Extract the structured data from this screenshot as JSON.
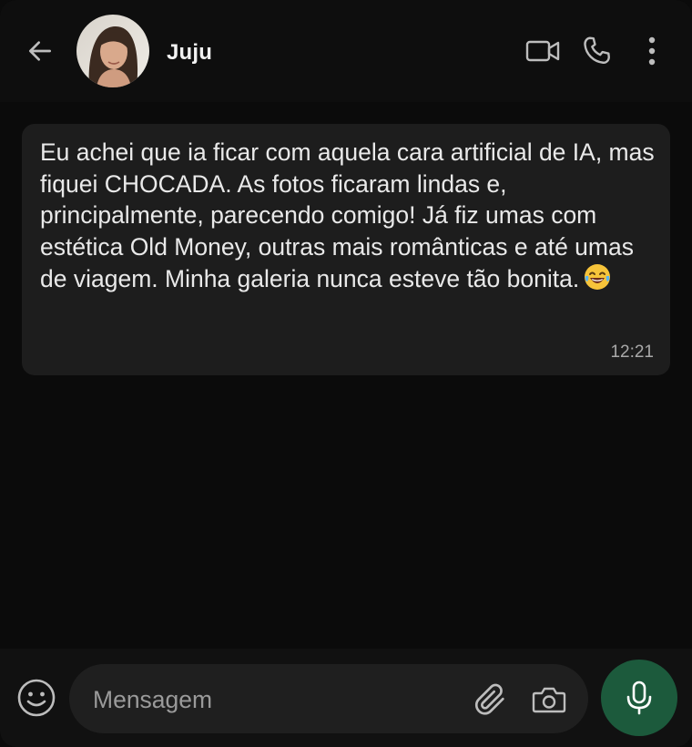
{
  "header": {
    "contact_name": "Juju",
    "back_icon": "arrow-left-icon",
    "video_icon": "video-camera-icon",
    "call_icon": "phone-icon",
    "menu_icon": "more-vertical-icon"
  },
  "messages": [
    {
      "text": "Eu achei que ia ficar com aquela cara artificial de IA, mas fiquei CHOCADA. As fotos ficaram lindas e, principalmente, parecendo comigo! Já fiz umas com estética Old Money, outras mais românticas e até umas de viagem. Minha galeria nunca esteve tão bonita.",
      "emoji": "rolling-on-floor-laughing-emoji",
      "time": "12:21"
    }
  ],
  "composer": {
    "placeholder": "Mensagem",
    "emoji_icon": "smiley-icon",
    "attach_icon": "paperclip-icon",
    "camera_icon": "camera-icon",
    "mic_icon": "microphone-icon"
  },
  "colors": {
    "background": "#0b0b0b",
    "bubble": "#1d1d1d",
    "accent": "#1c5a3c",
    "icon": "#c8c8c8"
  }
}
